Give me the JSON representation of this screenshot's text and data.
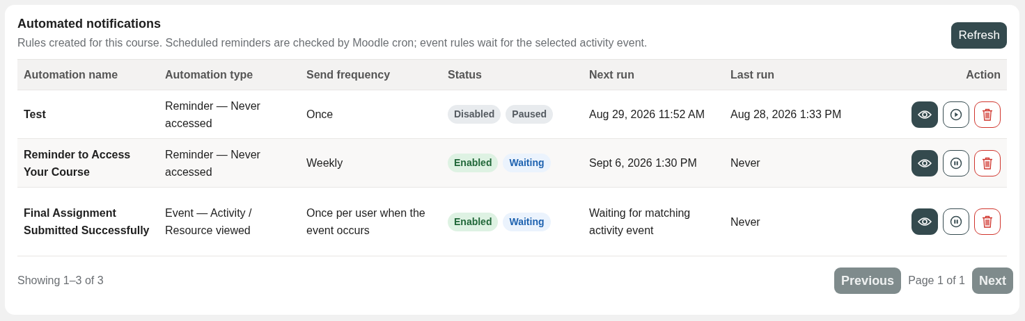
{
  "title": "Automated notifications",
  "subtitle": "Rules created for this course. Scheduled reminders are checked by Moodle cron; event rules wait for the selected activity event.",
  "refresh_button": "Refresh",
  "table": {
    "columns": [
      "Automation name",
      "Automation type",
      "Send frequency",
      "Status",
      "Next run",
      "Last run",
      "Action"
    ],
    "rows": [
      {
        "name": "Test",
        "type": "Reminder — Never accessed",
        "frequency": "Once",
        "badges": [
          {
            "label": "Disabled",
            "kind": "grey"
          },
          {
            "label": "Paused",
            "kind": "grey"
          }
        ],
        "next_run": "Aug 29, 2026 11:52 AM",
        "last_run": "Aug 28, 2026 1:33 PM",
        "toggle": {
          "kind": "play"
        }
      },
      {
        "name": "Reminder to Access Your Course",
        "type": "Reminder — Never accessed",
        "frequency": "Weekly",
        "badges": [
          {
            "label": "Enabled",
            "kind": "green"
          },
          {
            "label": "Waiting",
            "kind": "blue"
          }
        ],
        "next_run": "Sept 6, 2026 1:30 PM",
        "last_run": "Never",
        "toggle": {
          "kind": "pause"
        }
      },
      {
        "name": "Final Assignment Submitted Successfully",
        "type": "Event — Activity / Resource viewed",
        "frequency": "Once per user when the event occurs",
        "badges": [
          {
            "label": "Enabled",
            "kind": "green"
          },
          {
            "label": "Waiting",
            "kind": "blue"
          }
        ],
        "next_run": "Waiting for matching activity event",
        "last_run": "Never",
        "toggle": {
          "kind": "pause"
        }
      }
    ]
  },
  "footer": {
    "showing": "Showing 1–3 of 3",
    "previous": {
      "label": "Previous",
      "disabled": true
    },
    "page": "Page 1 of 1",
    "next": {
      "label": "Next",
      "disabled": true
    }
  }
}
